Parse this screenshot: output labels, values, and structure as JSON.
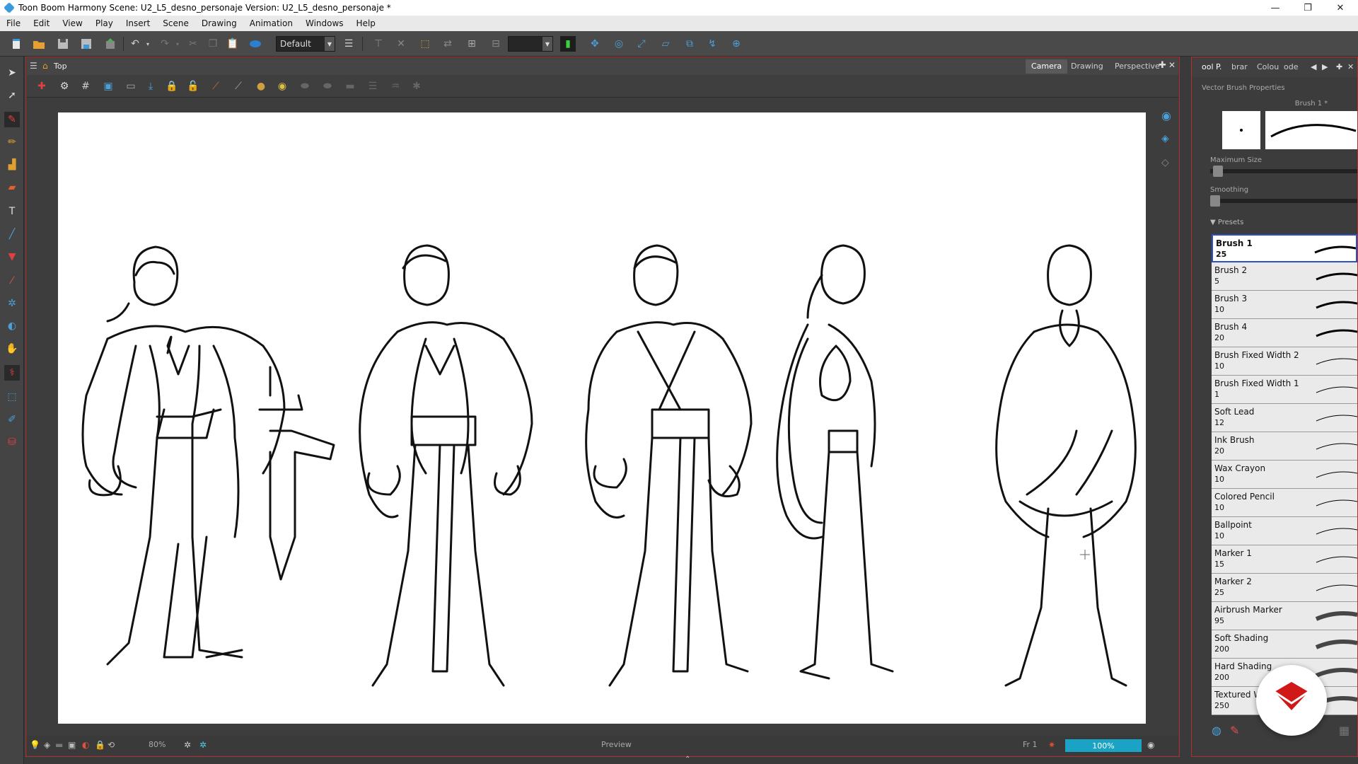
{
  "titlebar": {
    "title": "Toon Boom Harmony Scene: U2_L5_desno_personaje Version: U2_L5_desno_personaje *",
    "minimize": "—",
    "restore": "❐",
    "close": "✕"
  },
  "menubar": [
    "File",
    "Edit",
    "View",
    "Play",
    "Insert",
    "Scene",
    "Drawing",
    "Animation",
    "Windows",
    "Help"
  ],
  "toolbar": {
    "workspace_value": "Default"
  },
  "view": {
    "breadcrumb": "Top",
    "tabs": [
      "Camera",
      "Drawing",
      "Perspective"
    ],
    "active_tab": "Camera"
  },
  "status": {
    "zoom": "80%",
    "preview_label": "Preview",
    "frame": "Fr 1",
    "zoom_bar": "100%"
  },
  "right_panel": {
    "tabs": [
      "ool P.",
      "brar",
      "Colou",
      "ode"
    ],
    "title": "Vector Brush Properties",
    "brush_name": "Brush 1 *",
    "maximum_size_label": "Maximum Size",
    "smoothing_label": "Smoothing",
    "presets_label": "Presets",
    "presets": [
      {
        "name": "Brush 1",
        "size": "25"
      },
      {
        "name": "Brush 2",
        "size": "5"
      },
      {
        "name": "Brush 3",
        "size": "10"
      },
      {
        "name": "Brush 4",
        "size": "20"
      },
      {
        "name": "Brush Fixed Width 2",
        "size": "10"
      },
      {
        "name": "Brush Fixed Width 1",
        "size": "1"
      },
      {
        "name": "Soft Lead",
        "size": "12"
      },
      {
        "name": "Ink Brush",
        "size": "20"
      },
      {
        "name": "Wax Crayon",
        "size": "10"
      },
      {
        "name": "Colored Pencil",
        "size": "10"
      },
      {
        "name": "Ballpoint",
        "size": "10"
      },
      {
        "name": "Marker 1",
        "size": "15"
      },
      {
        "name": "Marker 2",
        "size": "25"
      },
      {
        "name": "Airbrush Marker",
        "size": "95"
      },
      {
        "name": "Soft Shading",
        "size": "200"
      },
      {
        "name": "Hard Shading",
        "size": "200"
      },
      {
        "name": "Textured W",
        "size": "250"
      }
    ]
  },
  "colors": {
    "accent": "#1aa3c4",
    "border_red": "#b03030",
    "selected_blue": "#3050c0",
    "badge_red": "#d01818"
  }
}
